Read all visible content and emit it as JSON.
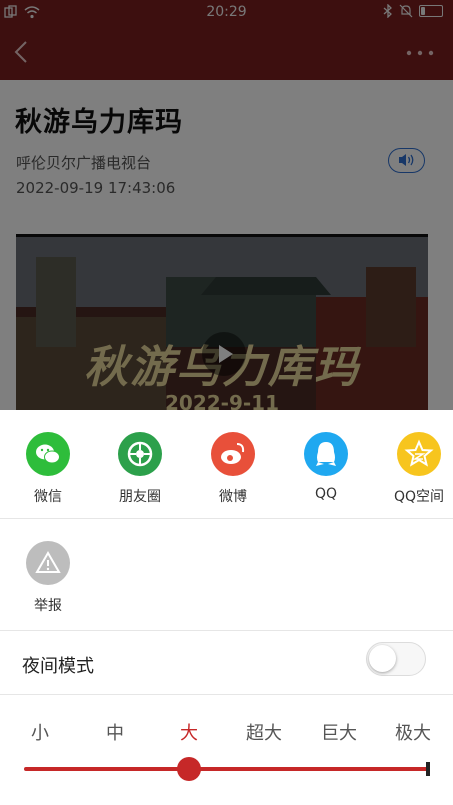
{
  "status_bar": {
    "time": "20:29",
    "battery_level": 0.2
  },
  "nav": {
    "back_icon": "chevron-left-icon",
    "more_icon": "more-dots-icon"
  },
  "article": {
    "title": "秋游乌力库玛",
    "source": "呼伦贝尔广播电视台",
    "datetime": "2022-09-19 17:43:06",
    "video_title": "秋游乌力库玛",
    "video_date": "2022-9-11"
  },
  "share_sheet": {
    "share_items": [
      {
        "label": "微信",
        "icon": "wechat-icon",
        "color": "#2ebd3b"
      },
      {
        "label": "朋友圈",
        "icon": "moments-icon",
        "color": "#2ca04b"
      },
      {
        "label": "微博",
        "icon": "weibo-icon",
        "color": "#e8503a"
      },
      {
        "label": "QQ",
        "icon": "qq-icon",
        "color": "#1fa8f0"
      },
      {
        "label": "QQ空间",
        "icon": "qzone-icon",
        "color": "#f7c51e"
      }
    ],
    "report": {
      "label": "举报",
      "icon": "warning-icon",
      "color": "#bdbdbd"
    },
    "night_mode": {
      "label": "夜间模式",
      "enabled": false
    },
    "font_size": {
      "options": [
        "小",
        "中",
        "大",
        "超大",
        "巨大",
        "极大"
      ],
      "selected": "大"
    }
  },
  "colors": {
    "brand_red": "#7a1e1e",
    "accent_red": "#c62828",
    "link_blue": "#2f6fd0"
  }
}
